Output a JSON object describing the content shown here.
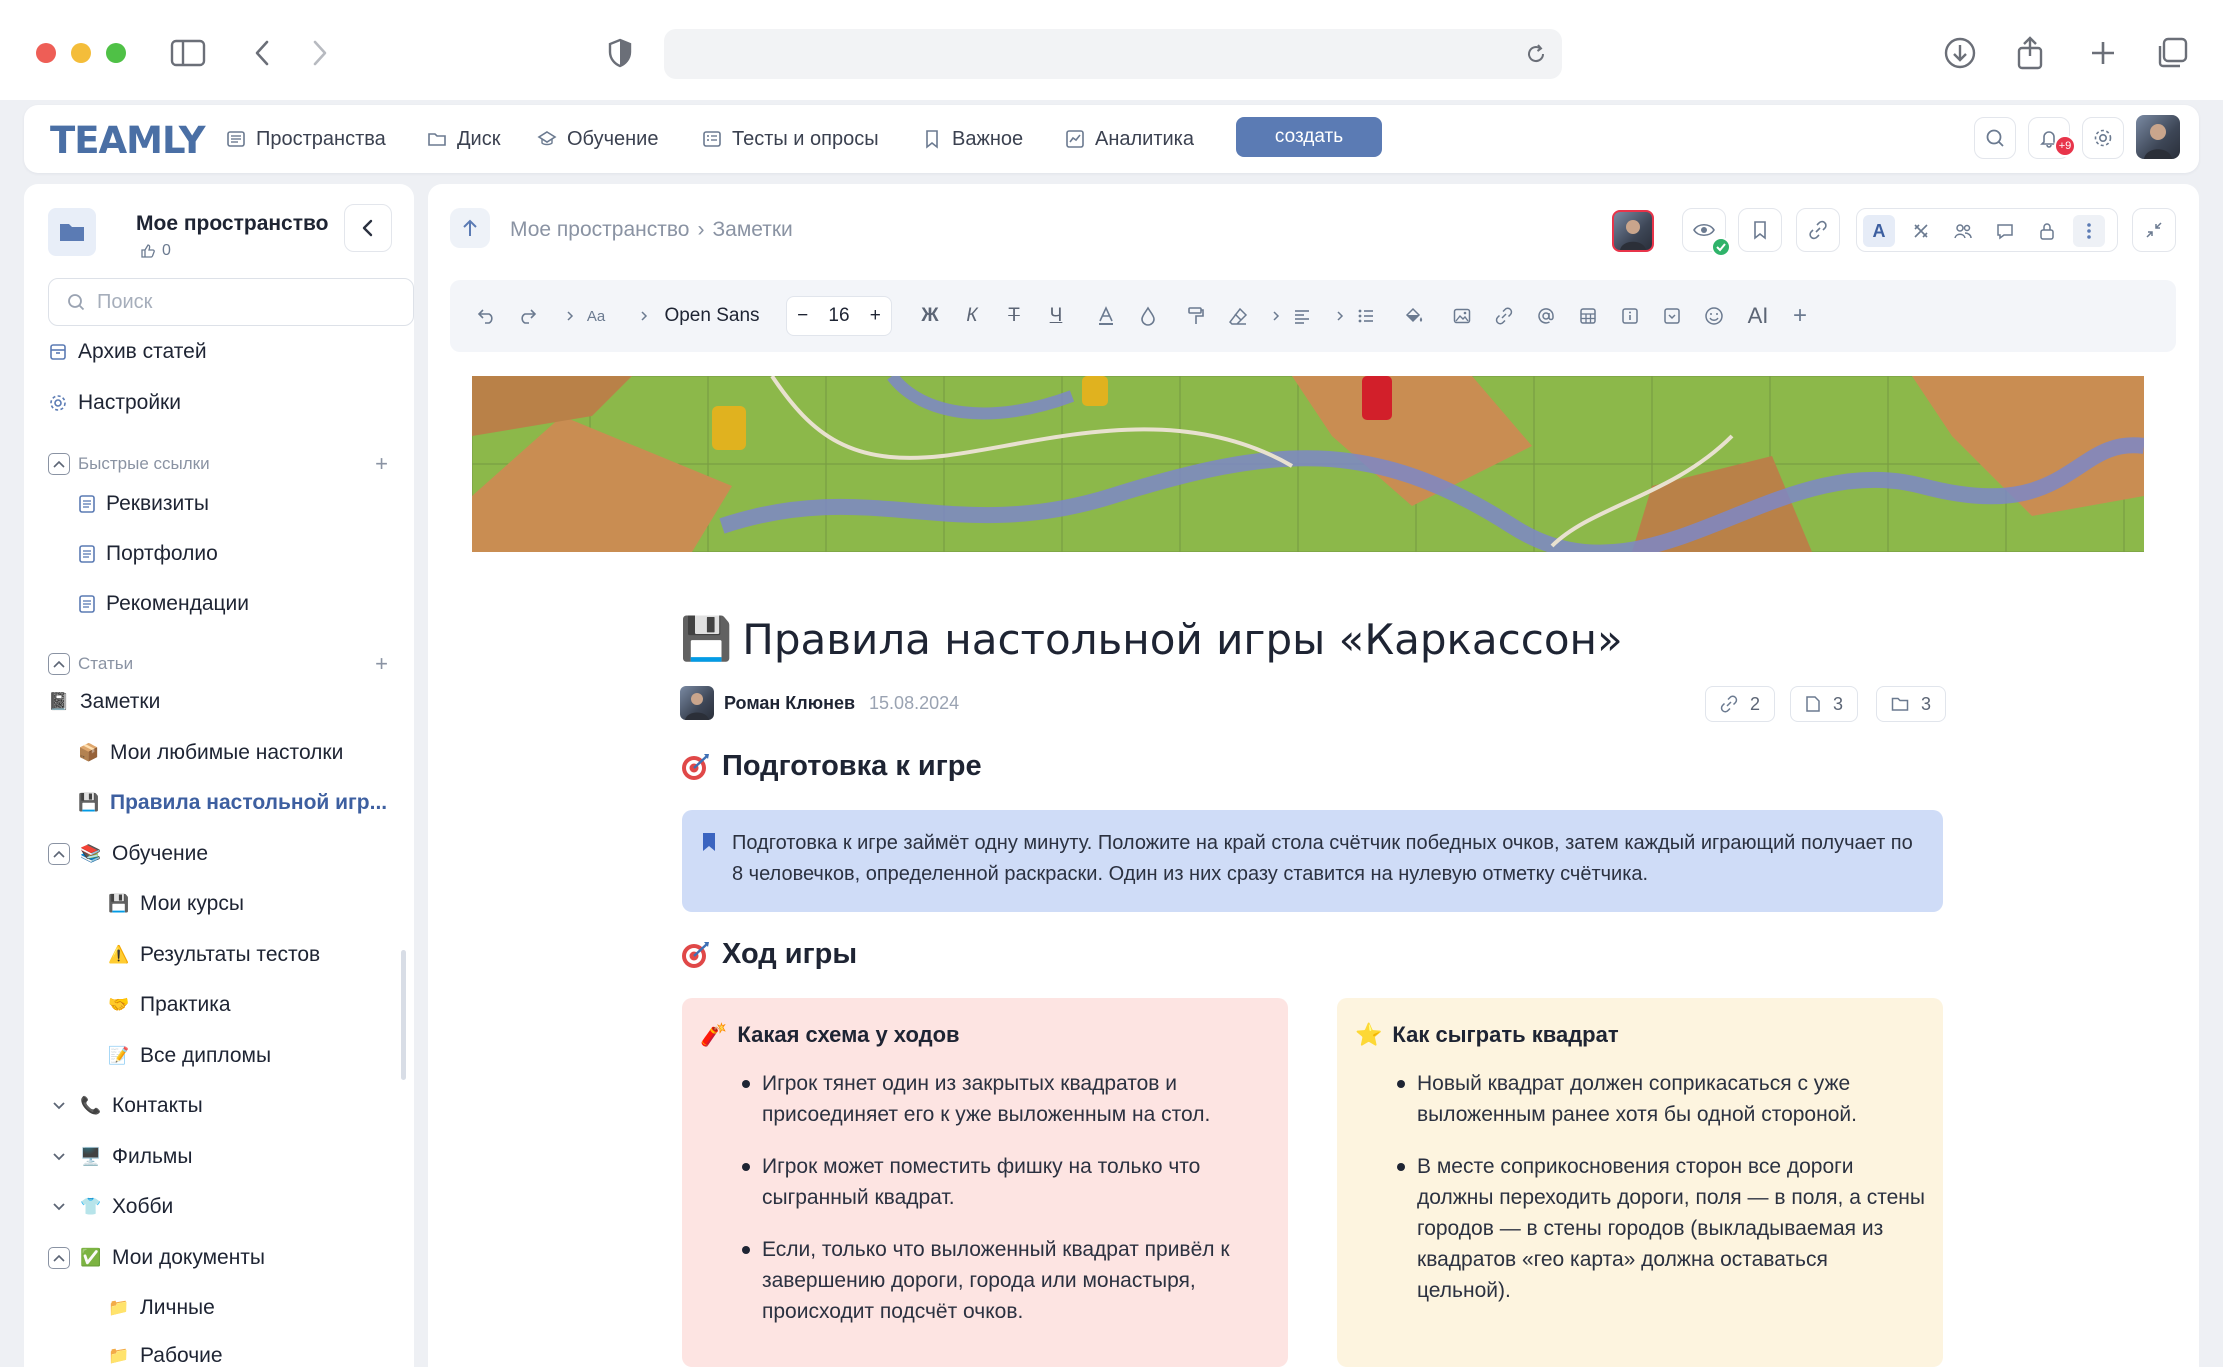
{
  "app": {
    "logo": "TEAMLY",
    "nav": [
      {
        "label": "Пространства",
        "icon": "spaces-icon"
      },
      {
        "label": "Диск",
        "icon": "folder-icon"
      },
      {
        "label": "Обучение",
        "icon": "learning-icon"
      },
      {
        "label": "Тесты и опросы",
        "icon": "tests-icon"
      },
      {
        "label": "Важное",
        "icon": "bookmark-icon"
      },
      {
        "label": "Аналитика",
        "icon": "analytics-icon"
      }
    ],
    "create_label": "создать",
    "notifications_badge": "+9"
  },
  "sidebar": {
    "space_title": "Мое пространство",
    "space_likes": "0",
    "search_placeholder": "Поиск",
    "top_items": [
      {
        "label": "Архив статей",
        "icon": "archive-icon"
      },
      {
        "label": "Настройки",
        "icon": "gear-icon"
      }
    ],
    "quick_links_title": "Быстрые ссылки",
    "quick_links": [
      "Реквизиты",
      "Портфолио",
      "Рекомендации"
    ],
    "articles_title": "Статьи",
    "tree": [
      {
        "label": "Заметки",
        "emoji": "📓",
        "level": 0
      },
      {
        "label": "Мои любимые настолки",
        "emoji": "📦",
        "level": 1
      },
      {
        "label": "Правила настольной игр...",
        "emoji": "💾",
        "level": 1,
        "active": true
      },
      {
        "label": "Обучение",
        "emoji": "📚",
        "level": 0,
        "toggle": "open"
      },
      {
        "label": "Мои курсы",
        "emoji": "💾",
        "level": 2
      },
      {
        "label": "Результаты тестов",
        "emoji": "⚠️",
        "level": 2
      },
      {
        "label": "Практика",
        "emoji": "🤝",
        "level": 2
      },
      {
        "label": "Все дипломы",
        "emoji": "📝",
        "level": 2
      },
      {
        "label": "Контакты",
        "emoji": "📞",
        "level": 0,
        "toggle": "closed"
      },
      {
        "label": "Фильмы",
        "emoji": "🖥️",
        "level": 0,
        "toggle": "closed"
      },
      {
        "label": "Хобби",
        "emoji": "👕",
        "level": 0,
        "toggle": "closed"
      },
      {
        "label": "Мои документы",
        "emoji": "✅",
        "level": 0,
        "toggle": "open"
      },
      {
        "label": "Личные",
        "emoji": "📁",
        "level": 2
      },
      {
        "label": "Рабочие",
        "emoji": "📁",
        "level": 2
      }
    ]
  },
  "breadcrumbs": [
    "Мое пространство",
    "Заметки"
  ],
  "editor": {
    "font_name": "Open Sans",
    "font_size": "16",
    "bold": "Ж",
    "italic": "К",
    "strike": "Т",
    "underline": "Ч",
    "ai_label": "AI",
    "format_label": "Aa"
  },
  "document": {
    "title_emoji": "💾",
    "title": "Правила настольной игры «Каркассон»",
    "author": "Роман Клюнев",
    "date": "15.08.2024",
    "links_count": "2",
    "pages_count": "3",
    "folders_count": "3",
    "section1": "Подготовка к игре",
    "callout": "Подготовка к игре займёт одну минуту. Положите на край стола счётчик победных очков, затем каждый играющий получает по 8 человечков, определенной раскраски. Один из них сразу ставится на нулевую отметку счётчика.",
    "section2": "Ход игры",
    "card1": {
      "emoji": "🧨",
      "title": "Какая схема у ходов",
      "items": [
        "Игрок тянет один из закрытых квадратов и присоединяет его к уже выложенным на стол.",
        "Игрок может поместить фишку на только что сыгранный квадрат.",
        "Если, только что выложенный квадрат привёл к завершению дороги, города или монастыря, происходит подсчёт очков."
      ]
    },
    "card2": {
      "emoji": "⭐",
      "title": "Как сыграть квадрат",
      "items": [
        "Новый квадрат должен соприкасаться с уже выложенным ранее хотя бы одной стороной.",
        "В месте соприкосновения сторон все дороги должны переходить дороги, поля — в поля, а стены городов — в стены городов (выкладываемая из квадратов «гео карта» должна оставаться цельной)."
      ]
    }
  },
  "colors": {
    "accent": "#5b7bb4",
    "callout_bg": "#cfdcf7",
    "card1_bg": "#fde4e2",
    "card2_bg": "#fdf4df",
    "badge": "#e8344a"
  }
}
